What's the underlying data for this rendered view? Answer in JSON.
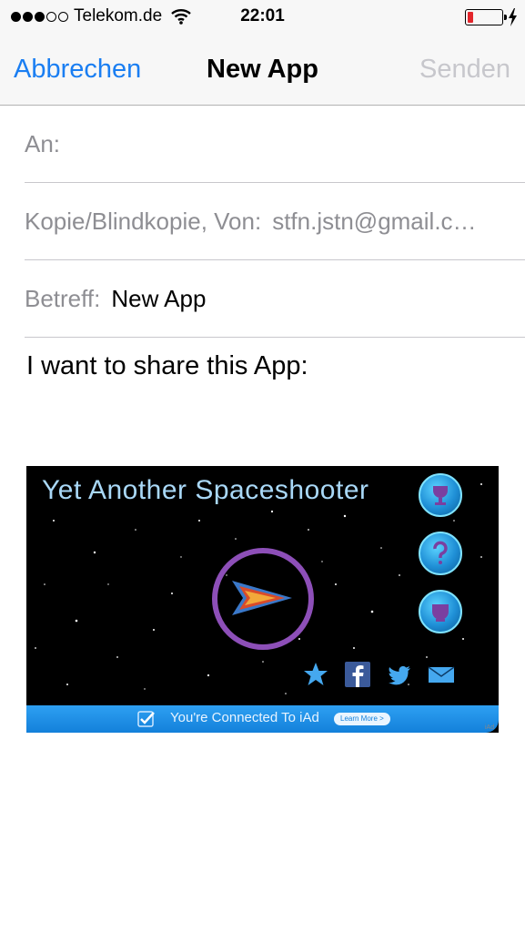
{
  "status_bar": {
    "carrier": "Telekom.de",
    "time": "22:01",
    "signal_bars_filled": 3,
    "signal_bars_total": 5,
    "battery_level": 0.15,
    "battery_color": "#e3262c"
  },
  "nav": {
    "cancel_label": "Abbrechen",
    "title": "New App",
    "send_label": "Senden",
    "accent_color": "#1a7ef2"
  },
  "fields": {
    "to_label": "An:",
    "cc_label": "Kopie/Blindkopie, Von:",
    "from_value": "stfn.jstn@gmail.com",
    "subject_label": "Betreff:",
    "subject_value": "New App"
  },
  "body": {
    "text": "I want to share this App:"
  },
  "attachment": {
    "game_title": "Yet Another Spaceshooter",
    "buttons": [
      "trophy-icon",
      "help-icon",
      "options-icon"
    ],
    "share_icons": [
      "star-icon",
      "facebook-icon",
      "twitter-icon",
      "mail-icon"
    ],
    "iad_text": "You're Connected To iAd",
    "iad_learn_more": "Learn More >",
    "iad_tag": "iAd"
  }
}
